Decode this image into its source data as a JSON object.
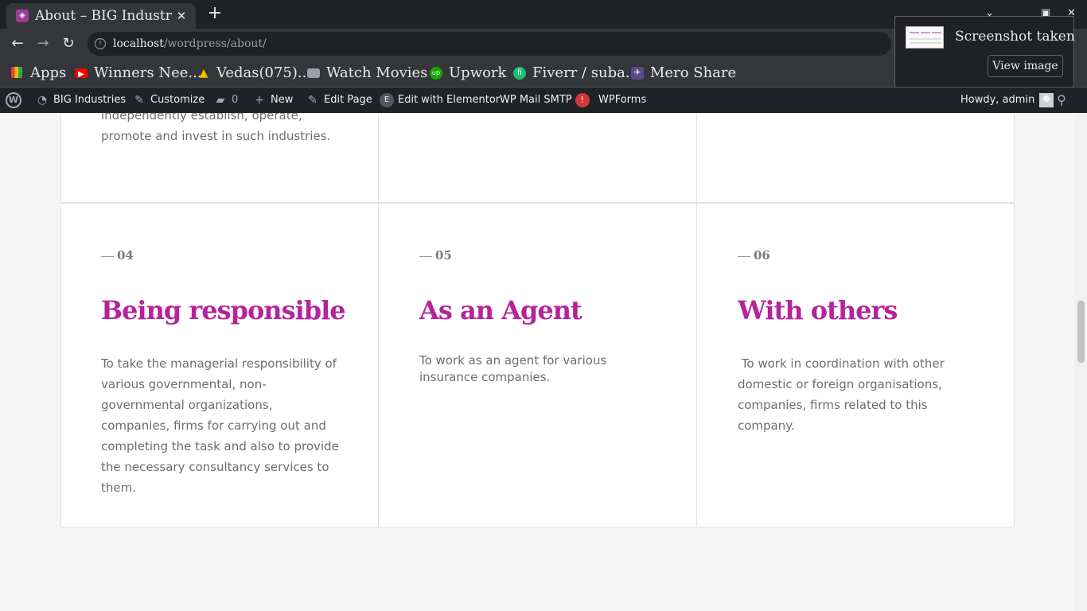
{
  "browser": {
    "tab": {
      "title": "About – BIG Industries",
      "close": "✕"
    },
    "new_tab": "+",
    "window_controls": {
      "minimize": "⌄",
      "maximize": "▣",
      "close": "✕"
    },
    "nav": {
      "back": "←",
      "forward": "→",
      "reload": "↻"
    },
    "address": {
      "host": "localhost",
      "path": "/wordpress/about/"
    },
    "bookmarks": [
      {
        "label": "Apps",
        "icon": "apps-grid-icon",
        "color": "#e8eaed"
      },
      {
        "label": "Winners Nee...",
        "icon": "youtube-icon",
        "color": "#ff0000"
      },
      {
        "label": "Vedas(075)...",
        "icon": "google-drive-icon",
        "color": "#1fa463"
      },
      {
        "label": "Watch Movies",
        "icon": "folder-icon",
        "color": "#9aa0a6"
      },
      {
        "label": "Upwork",
        "icon": "upwork-icon",
        "color": "#14a800"
      },
      {
        "label": "Fiverr / suba...",
        "icon": "fiverr-icon",
        "color": "#1dbf73"
      },
      {
        "label": "Mero Share",
        "icon": "mero-share-icon",
        "color": "#5a4a8a"
      }
    ]
  },
  "toast": {
    "title": "Screenshot taken",
    "button": "View image"
  },
  "adminbar": {
    "site": "BIG Industries",
    "customize": "Customize",
    "comments": "0",
    "new": "New",
    "edit_page": "Edit Page",
    "elementor": "Edit with Elementor",
    "smtp": "WP Mail SMTP",
    "smtp_badge": "!",
    "wpforms": "WPForms",
    "greeting": "Howdy, admin"
  },
  "page": {
    "prev_text": "independently establish, operate, promote and invest in such industries.",
    "cards": [
      {
        "number": "04",
        "title": "Being responsible",
        "text": "To take the managerial responsibility of various governmental, non-governmental organizations, companies, firms for carrying out and completing the task and also to provide the necessary consultancy services to them."
      },
      {
        "number": "05",
        "title": "As an Agent",
        "text": "To work as an agent for various insurance companies."
      },
      {
        "number": "06",
        "title": "With others",
        "text": " To work in coordination with other domestic or foreign organisations, companies, firms related to this company."
      }
    ]
  },
  "colors": {
    "accent": "#b5249b",
    "adminbar": "#1d2327",
    "browser_chrome": "#35363a"
  }
}
